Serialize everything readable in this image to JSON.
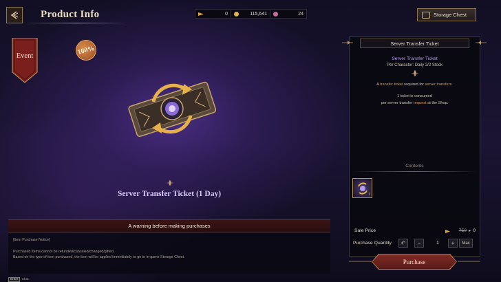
{
  "header": {
    "title": "Product Info",
    "currencies": [
      {
        "icon": "ticket-currency-icon",
        "value": "0",
        "color": "#d9a84a"
      },
      {
        "icon": "gold-coin-icon",
        "value": "115,641",
        "color": "#e0b34e"
      },
      {
        "icon": "crystal-currency-icon",
        "value": "24",
        "color": "#c86aa0"
      }
    ],
    "storage_label": "Storage Chest"
  },
  "left": {
    "event_label": "Event",
    "badge_text": "100%",
    "item_name": "Server Transfer Ticket (1 Day)",
    "warning_title": "A warning before making purchases",
    "notice_heading": "[Item Purchase Notice]",
    "notice_line1": "Purchased Items cannot be refunded/canceled/changed/gifted.",
    "notice_line2": "Based on the type of item purchased, the item will be applied immediately or go to in-game Storage Chest."
  },
  "panel": {
    "header": "Server Transfer Ticket",
    "item_title": "Server Transfer Ticket",
    "limit": "Per Character:  Daily 2/2 Stock",
    "desc1_a": "A ",
    "desc1_hl1": "transfer ticket",
    "desc1_b": " required for ",
    "desc1_hl2": "server transfers",
    "desc1_c": ".",
    "desc2": "1 ticket is consumed",
    "desc3_a": "per server transfer ",
    "desc3_hl": "request",
    "desc3_b": " at the Shop.",
    "contents_label": "Contents",
    "content_count": "1",
    "sale_price_label": "Sale Price",
    "old_price": "750",
    "new_price": "0",
    "quantity_label": "Purchase Quantity",
    "quantity": "1",
    "max_label": "Max",
    "purchase_label": "Purchase"
  },
  "footer": {
    "chat_key": "Enter",
    "chat_label": "Chat"
  }
}
